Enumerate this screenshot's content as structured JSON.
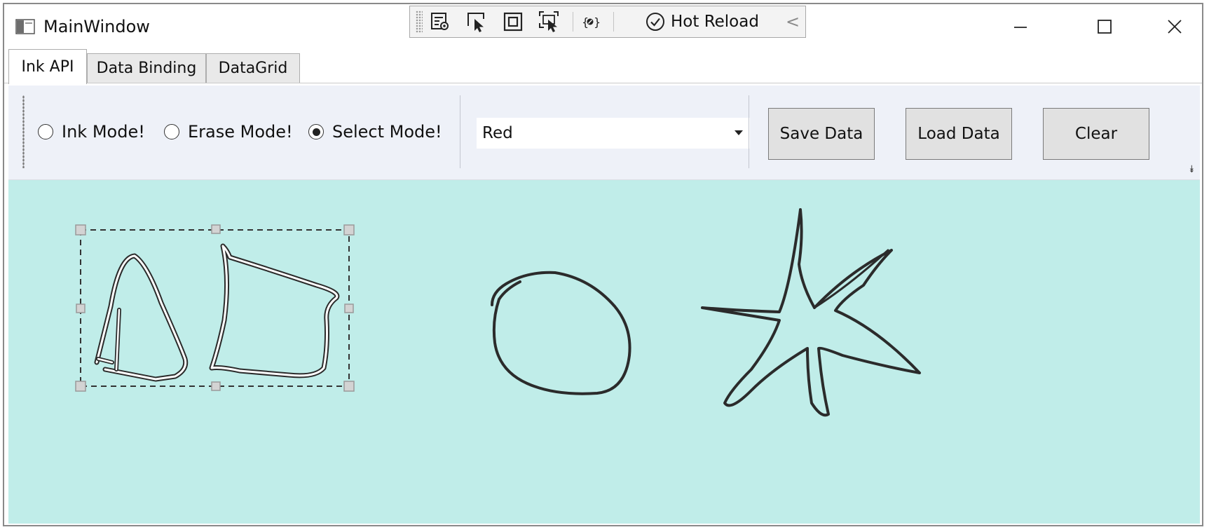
{
  "window": {
    "title": "MainWindow",
    "controls": [
      "minimize-icon",
      "maximize-icon",
      "close-icon"
    ]
  },
  "dev_toolbar": {
    "icons": [
      "live-visual-tree-icon",
      "select-element-icon",
      "display-layout-adorners-icon",
      "track-focus-icon",
      "binding-failures-icon"
    ],
    "hot_reload_label": "Hot Reload",
    "collapse_glyph": "<"
  },
  "tabs": [
    {
      "label": "Ink API",
      "active": true
    },
    {
      "label": "Data Binding",
      "active": false
    },
    {
      "label": "DataGrid",
      "active": false
    }
  ],
  "ink_toolbar": {
    "modes": [
      {
        "label": "Ink Mode!",
        "checked": false
      },
      {
        "label": "Erase Mode!",
        "checked": false
      },
      {
        "label": "Select Mode!",
        "checked": true
      }
    ],
    "color_select": {
      "value": "Red"
    },
    "buttons": {
      "save": "Save Data",
      "load": "Load Data",
      "clear": "Clear"
    }
  },
  "canvas": {
    "background": "#c0ede9",
    "stroke_color": "#2b2b2b",
    "strokes": [
      "triangle",
      "trapezoid",
      "circle",
      "star"
    ],
    "selected_strokes": [
      "triangle",
      "trapezoid"
    ]
  }
}
